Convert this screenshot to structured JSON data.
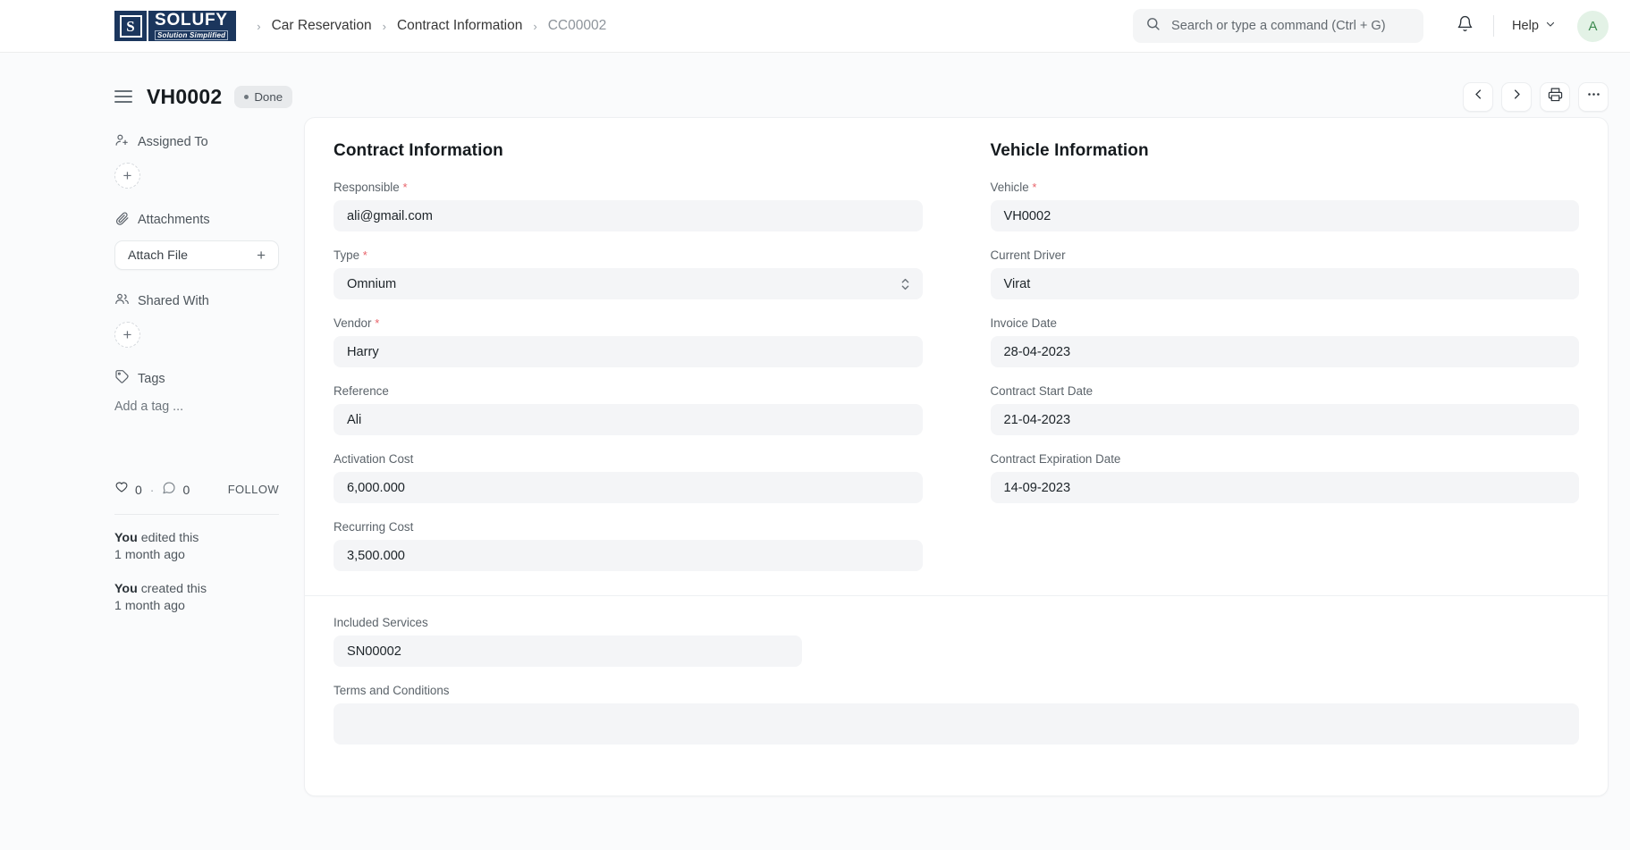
{
  "navbar": {
    "logo": {
      "mark": "S",
      "brand": "SOLUFY",
      "tagline": "Solution Simplified"
    },
    "breadcrumb": [
      {
        "label": "Car Reservation",
        "current": false
      },
      {
        "label": "Contract Information",
        "current": false
      },
      {
        "label": "CC00002",
        "current": true
      }
    ],
    "separator": "›",
    "search": {
      "placeholder": "Search or type a command (Ctrl + G)",
      "icon": "search-icon"
    },
    "notification_icon": "bell-icon",
    "help": {
      "label": "Help",
      "icon": "chevron-down-icon"
    },
    "avatar": {
      "initial": "A",
      "bg": "#e3f2e6",
      "fg": "#3d8a4f"
    }
  },
  "page_head": {
    "menu_icon": "hamburger-icon",
    "title": "VH0002",
    "status": {
      "label": "Done",
      "dot_color": "#6f777e",
      "bg": "#e8eaec"
    },
    "actions": [
      {
        "name": "prev-button",
        "icon": "chevron-left-icon"
      },
      {
        "name": "next-button",
        "icon": "chevron-right-icon"
      },
      {
        "name": "print-button",
        "icon": "print-icon"
      },
      {
        "name": "more-button",
        "icon": "ellipsis-icon"
      }
    ]
  },
  "sidebar": {
    "assigned_to": {
      "label": "Assigned To",
      "icon": "user-plus-icon",
      "add_label": "+"
    },
    "attachments": {
      "label": "Attachments",
      "icon": "paperclip-icon",
      "button_label": "Attach File",
      "add_label": "+"
    },
    "shared_with": {
      "label": "Shared With",
      "icon": "users-icon",
      "add_label": "+"
    },
    "tags": {
      "label": "Tags",
      "icon": "tag-icon",
      "placeholder": "Add a tag ..."
    },
    "social": {
      "like_icon": "heart-icon",
      "like_count": "0",
      "separator": "·",
      "comment_icon": "comment-icon",
      "comment_count": "0",
      "follow_label": "FOLLOW"
    },
    "activity": [
      {
        "actor": "You",
        "action": " edited this",
        "time": "1 month ago"
      },
      {
        "actor": "You",
        "action": " created this",
        "time": "1 month ago"
      }
    ]
  },
  "form": {
    "left": {
      "heading": "Contract Information",
      "fields": [
        {
          "label": "Responsible",
          "required": true,
          "value": "ali@gmail.com",
          "type": "text",
          "name": "responsible-field"
        },
        {
          "label": "Type",
          "required": true,
          "value": "Omnium",
          "type": "select",
          "name": "type-field"
        },
        {
          "label": "Vendor",
          "required": true,
          "value": "Harry",
          "type": "text",
          "name": "vendor-field"
        },
        {
          "label": "Reference",
          "required": false,
          "value": "Ali",
          "type": "text",
          "name": "reference-field"
        },
        {
          "label": "Activation Cost",
          "required": false,
          "value": "6,000.000",
          "type": "text",
          "name": "activation-cost-field"
        },
        {
          "label": "Recurring Cost",
          "required": false,
          "value": "3,500.000",
          "type": "text",
          "name": "recurring-cost-field"
        }
      ]
    },
    "right": {
      "heading": "Vehicle Information",
      "fields": [
        {
          "label": "Vehicle",
          "required": true,
          "value": "VH0002",
          "type": "text",
          "name": "vehicle-field"
        },
        {
          "label": "Current Driver",
          "required": false,
          "value": "Virat",
          "type": "text",
          "name": "current-driver-field"
        },
        {
          "label": "Invoice Date",
          "required": false,
          "value": "28-04-2023",
          "type": "text",
          "name": "invoice-date-field"
        },
        {
          "label": "Contract Start Date",
          "required": false,
          "value": "21-04-2023",
          "type": "text",
          "name": "contract-start-date-field"
        },
        {
          "label": "Contract Expiration Date",
          "required": false,
          "value": "14-09-2023",
          "type": "text",
          "name": "contract-expiration-date-field"
        }
      ]
    },
    "bottom": {
      "included_services": {
        "label": "Included Services",
        "value": "SN00002"
      },
      "terms": {
        "label": "Terms and Conditions",
        "value": ""
      }
    }
  }
}
